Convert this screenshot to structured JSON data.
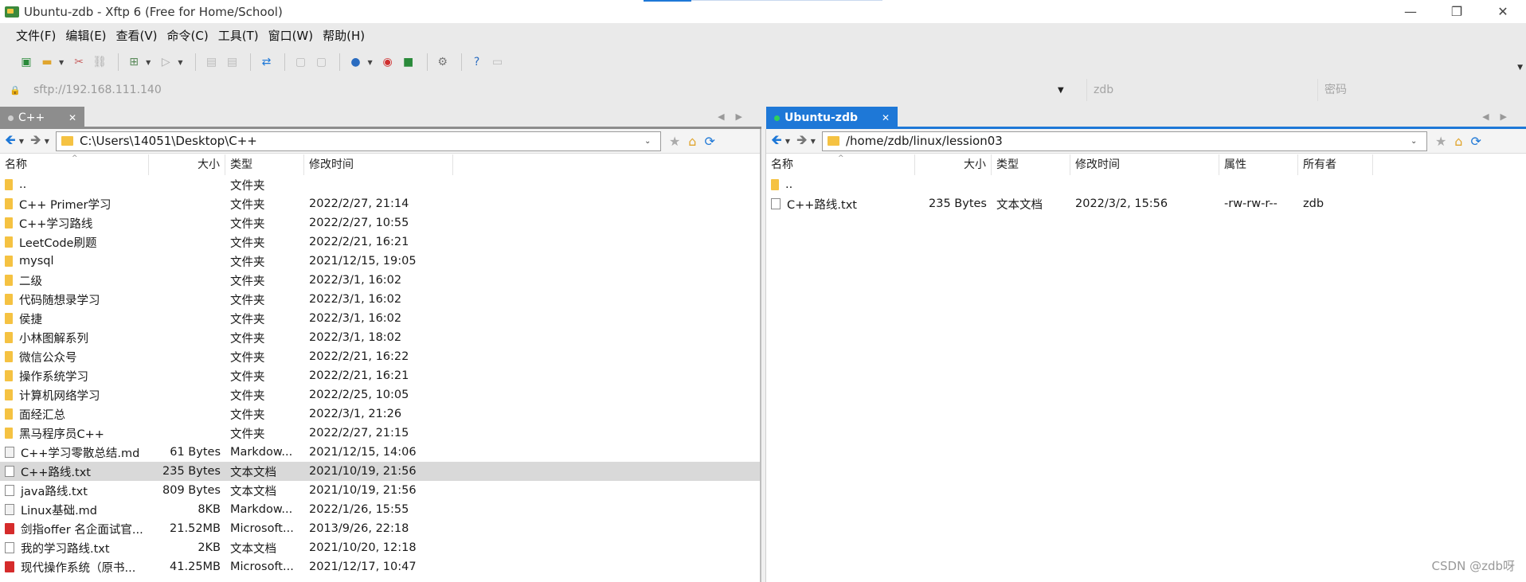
{
  "window": {
    "title": "Ubuntu-zdb - Xftp 6 (Free for Home/School)",
    "minimize": "—",
    "maximize": "❐",
    "close": "✕"
  },
  "menu": [
    "文件(F)",
    "编辑(E)",
    "查看(V)",
    "命令(C)",
    "工具(T)",
    "窗口(W)",
    "帮助(H)"
  ],
  "toolbar": {
    "icons": [
      "new-session-icon",
      "open-folder-icon",
      "disconnect-icon",
      "reconnect-icon",
      "transfer-icon",
      "play-icon",
      "copy-icon",
      "paste-icon",
      "sync-icon",
      "properties-icon",
      "duplicate-icon",
      "globe-icon",
      "xshell-icon",
      "xftp-icon",
      "settings-icon",
      "help-icon",
      "chat-icon"
    ]
  },
  "address": {
    "url_placeholder": "sftp://192.168.111.140",
    "user_placeholder": "zdb",
    "password_placeholder": "密码"
  },
  "left": {
    "tab_label": "C++",
    "path": "C:\\Users\\14051\\Desktop\\C++",
    "columns": {
      "name": "名称",
      "size": "大小",
      "type": "类型",
      "modified": "修改时间"
    },
    "rows": [
      {
        "icon": "folder",
        "name": "..",
        "size": "",
        "type": "文件夹",
        "modified": ""
      },
      {
        "icon": "folder",
        "name": "C++ Primer学习",
        "size": "",
        "type": "文件夹",
        "modified": "2022/2/27, 21:14"
      },
      {
        "icon": "folder",
        "name": "C++学习路线",
        "size": "",
        "type": "文件夹",
        "modified": "2022/2/27, 10:55"
      },
      {
        "icon": "folder",
        "name": "LeetCode刷题",
        "size": "",
        "type": "文件夹",
        "modified": "2022/2/21, 16:21"
      },
      {
        "icon": "folder",
        "name": "mysql",
        "size": "",
        "type": "文件夹",
        "modified": "2021/12/15, 19:05"
      },
      {
        "icon": "folder",
        "name": "二级",
        "size": "",
        "type": "文件夹",
        "modified": "2022/3/1, 16:02"
      },
      {
        "icon": "folder",
        "name": "代码随想录学习",
        "size": "",
        "type": "文件夹",
        "modified": "2022/3/1, 16:02"
      },
      {
        "icon": "folder",
        "name": "侯捷",
        "size": "",
        "type": "文件夹",
        "modified": "2022/3/1, 16:02"
      },
      {
        "icon": "folder",
        "name": "小林图解系列",
        "size": "",
        "type": "文件夹",
        "modified": "2022/3/1, 18:02"
      },
      {
        "icon": "folder",
        "name": "微信公众号",
        "size": "",
        "type": "文件夹",
        "modified": "2022/2/21, 16:22"
      },
      {
        "icon": "folder",
        "name": "操作系统学习",
        "size": "",
        "type": "文件夹",
        "modified": "2022/2/21, 16:21"
      },
      {
        "icon": "folder",
        "name": "计算机网络学习",
        "size": "",
        "type": "文件夹",
        "modified": "2022/2/25, 10:05"
      },
      {
        "icon": "folder",
        "name": "面经汇总",
        "size": "",
        "type": "文件夹",
        "modified": "2022/3/1, 21:26"
      },
      {
        "icon": "folder",
        "name": "黑马程序员C++",
        "size": "",
        "type": "文件夹",
        "modified": "2022/2/27, 21:15"
      },
      {
        "icon": "md",
        "name": "C++学习零散总结.md",
        "size": "61 Bytes",
        "type": "Markdow...",
        "modified": "2021/12/15, 14:06"
      },
      {
        "icon": "file",
        "name": "C++路线.txt",
        "size": "235 Bytes",
        "type": "文本文档",
        "modified": "2021/10/19, 21:56",
        "selected": true
      },
      {
        "icon": "file",
        "name": "java路线.txt",
        "size": "809 Bytes",
        "type": "文本文档",
        "modified": "2021/10/19, 21:56"
      },
      {
        "icon": "md",
        "name": "Linux基础.md",
        "size": "8KB",
        "type": "Markdow...",
        "modified": "2022/1/26, 15:55"
      },
      {
        "icon": "pdf",
        "name": "剑指offer 名企面试官...",
        "size": "21.52MB",
        "type": "Microsoft...",
        "modified": "2013/9/26, 22:18"
      },
      {
        "icon": "file",
        "name": "我的学习路线.txt",
        "size": "2KB",
        "type": "文本文档",
        "modified": "2021/10/20, 12:18"
      },
      {
        "icon": "pdf",
        "name": "现代操作系统（原书...",
        "size": "41.25MB",
        "type": "Microsoft...",
        "modified": "2021/12/17, 10:47"
      }
    ]
  },
  "right": {
    "tab_label": "Ubuntu-zdb",
    "path": "/home/zdb/linux/lession03",
    "columns": {
      "name": "名称",
      "size": "大小",
      "type": "类型",
      "modified": "修改时间",
      "attr": "属性",
      "owner": "所有者"
    },
    "rows": [
      {
        "icon": "folder",
        "name": "..",
        "size": "",
        "type": "",
        "modified": "",
        "attr": "",
        "owner": ""
      },
      {
        "icon": "file",
        "name": "C++路线.txt",
        "size": "235 Bytes",
        "type": "文本文档",
        "modified": "2022/3/2, 15:56",
        "attr": "-rw-rw-r--",
        "owner": "zdb"
      }
    ]
  },
  "watermark": "CSDN @zdb呀",
  "colors": {
    "accent": "#1e78d7",
    "folder": "#f5c242",
    "selected_row": "#d9d9d9"
  }
}
